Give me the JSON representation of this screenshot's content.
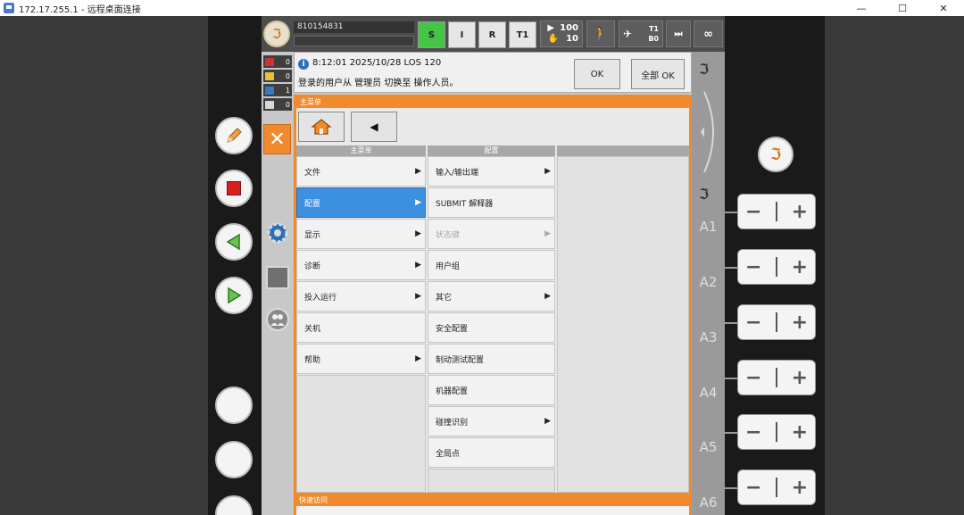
{
  "window": {
    "title": "172.17.255.1 - 远程桌面连接",
    "minimize": "—",
    "maximize": "☐",
    "close": "✕"
  },
  "status_bar": {
    "serial": "810154831",
    "mode_buttons": [
      {
        "label": "S",
        "active": true
      },
      {
        "label": "I",
        "active": false
      },
      {
        "label": "R",
        "active": false
      },
      {
        "label": "T1",
        "active": false
      }
    ],
    "override_program": "100",
    "override_jog": "10",
    "tool_top": "T1",
    "tool_bottom": "B0",
    "incremental": "∞"
  },
  "message_counters": [
    "0",
    "0",
    "1",
    "0"
  ],
  "message": {
    "line1": "8:12:01 2025/10/28 LOS 120",
    "line2": "登录的用户从 管理员 切换至 操作人员。",
    "ok_label": "OK",
    "ok_all_label": "全部 OK"
  },
  "main_menu": {
    "title": "主菜单",
    "left_header": "主菜单",
    "right_header": "配置",
    "left_items": [
      {
        "label": "文件",
        "submenu": true,
        "selected": false
      },
      {
        "label": "配置",
        "submenu": true,
        "selected": true
      },
      {
        "label": "显示",
        "submenu": true,
        "selected": false
      },
      {
        "label": "诊断",
        "submenu": true,
        "selected": false
      },
      {
        "label": "投入运行",
        "submenu": true,
        "selected": false
      },
      {
        "label": "关机",
        "submenu": false,
        "selected": false
      },
      {
        "label": "帮助",
        "submenu": true,
        "selected": false
      }
    ],
    "right_items": [
      {
        "label": "输入/输出端",
        "submenu": true,
        "disabled": false
      },
      {
        "label": "SUBMIT 解释器",
        "submenu": false,
        "disabled": false
      },
      {
        "label": "状态键",
        "submenu": true,
        "disabled": true
      },
      {
        "label": "用户组",
        "submenu": false,
        "disabled": false
      },
      {
        "label": "其它",
        "submenu": true,
        "disabled": false
      },
      {
        "label": "安全配置",
        "submenu": false,
        "disabled": false
      },
      {
        "label": "制动测试配置",
        "submenu": false,
        "disabled": false
      },
      {
        "label": "机器配置",
        "submenu": false,
        "disabled": false
      },
      {
        "label": "碰撞识别",
        "submenu": true,
        "disabled": false
      },
      {
        "label": "全局点",
        "submenu": false,
        "disabled": false
      }
    ]
  },
  "quick_access": {
    "title": "快速访问"
  },
  "jog": {
    "axes": [
      "A1",
      "A2",
      "A3",
      "A4",
      "A5",
      "A6"
    ],
    "minus": "−",
    "plus": "+"
  },
  "colors": {
    "accent": "#f08a2c",
    "selected": "#3d8fe0",
    "mode_active": "#44c545"
  },
  "icons": {
    "submenu_arrow": "▶",
    "close": "✕",
    "home": "home-icon",
    "back": "◀"
  }
}
